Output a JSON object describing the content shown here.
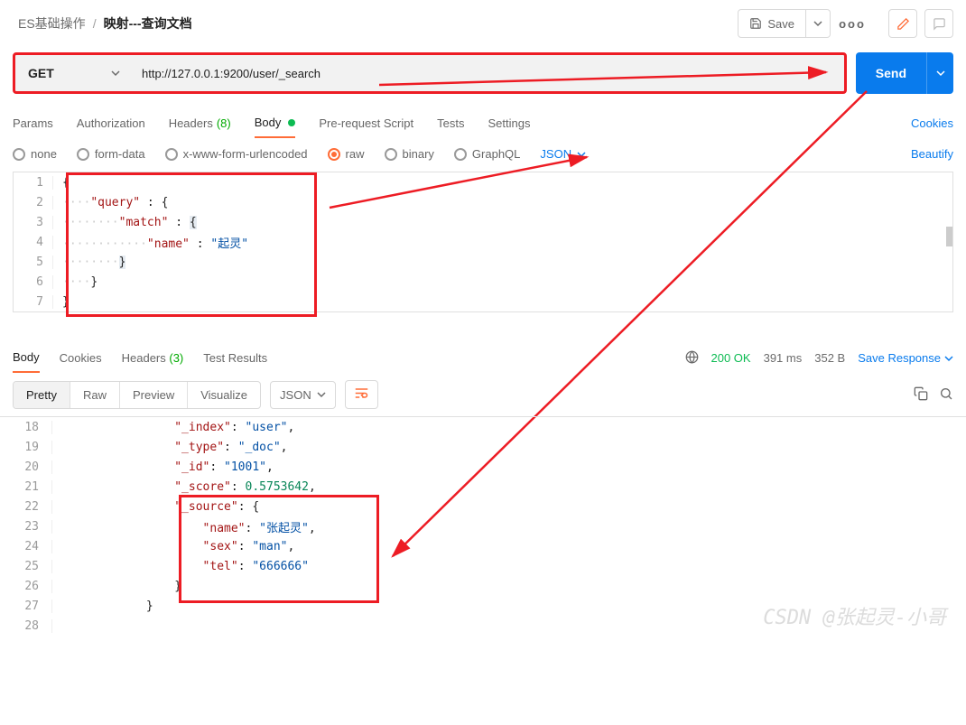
{
  "breadcrumb": {
    "parent": "ES基础操作",
    "current": "映射---查询文档"
  },
  "toolbar": {
    "save": "Save"
  },
  "request": {
    "method": "GET",
    "url": "http://127.0.0.1:9200/user/_search",
    "send": "Send"
  },
  "tabs": {
    "params": "Params",
    "auth": "Authorization",
    "headers": "Headers",
    "headers_count": "(8)",
    "body": "Body",
    "prerequest": "Pre-request Script",
    "tests": "Tests",
    "settings": "Settings",
    "cookies": "Cookies"
  },
  "body_opts": {
    "none": "none",
    "formdata": "form-data",
    "xwww": "x-www-form-urlencoded",
    "raw": "raw",
    "binary": "binary",
    "graphql": "GraphQL",
    "json": "JSON",
    "beautify": "Beautify"
  },
  "req_editor": {
    "l1": "{",
    "l2_key": "\"query\"",
    "l2_rest": " : {",
    "l3_key": "\"match\"",
    "l3_rest": " : {",
    "l4_key": "\"name\"",
    "l4_val": "\"起灵\"",
    "l5": "}",
    "l6": "}",
    "l7": "}"
  },
  "resp_tabs": {
    "body": "Body",
    "cookies": "Cookies",
    "headers": "Headers",
    "headers_count": "(3)",
    "testresults": "Test Results"
  },
  "resp_meta": {
    "status": "200 OK",
    "time": "391 ms",
    "size": "352 B",
    "save": "Save Response"
  },
  "resp_opts": {
    "pretty": "Pretty",
    "raw": "Raw",
    "preview": "Preview",
    "visualize": "Visualize",
    "json": "JSON"
  },
  "resp_body": {
    "l18_key": "\"_index\"",
    "l18_val": "\"user\"",
    "l19_key": "\"_type\"",
    "l19_val": "\"_doc\"",
    "l20_key": "\"_id\"",
    "l20_val": "\"1001\"",
    "l21_key": "\"_score\"",
    "l21_val": "0.5753642",
    "l22_key": "\"_source\"",
    "l23_key": "\"name\"",
    "l23_val": "\"张起灵\"",
    "l24_key": "\"sex\"",
    "l24_val": "\"man\"",
    "l25_key": "\"tel\"",
    "l25_val": "\"666666\"",
    "l26": "}",
    "l27": "}",
    "l28": ""
  },
  "watermark": "CSDN @张起灵-小哥"
}
